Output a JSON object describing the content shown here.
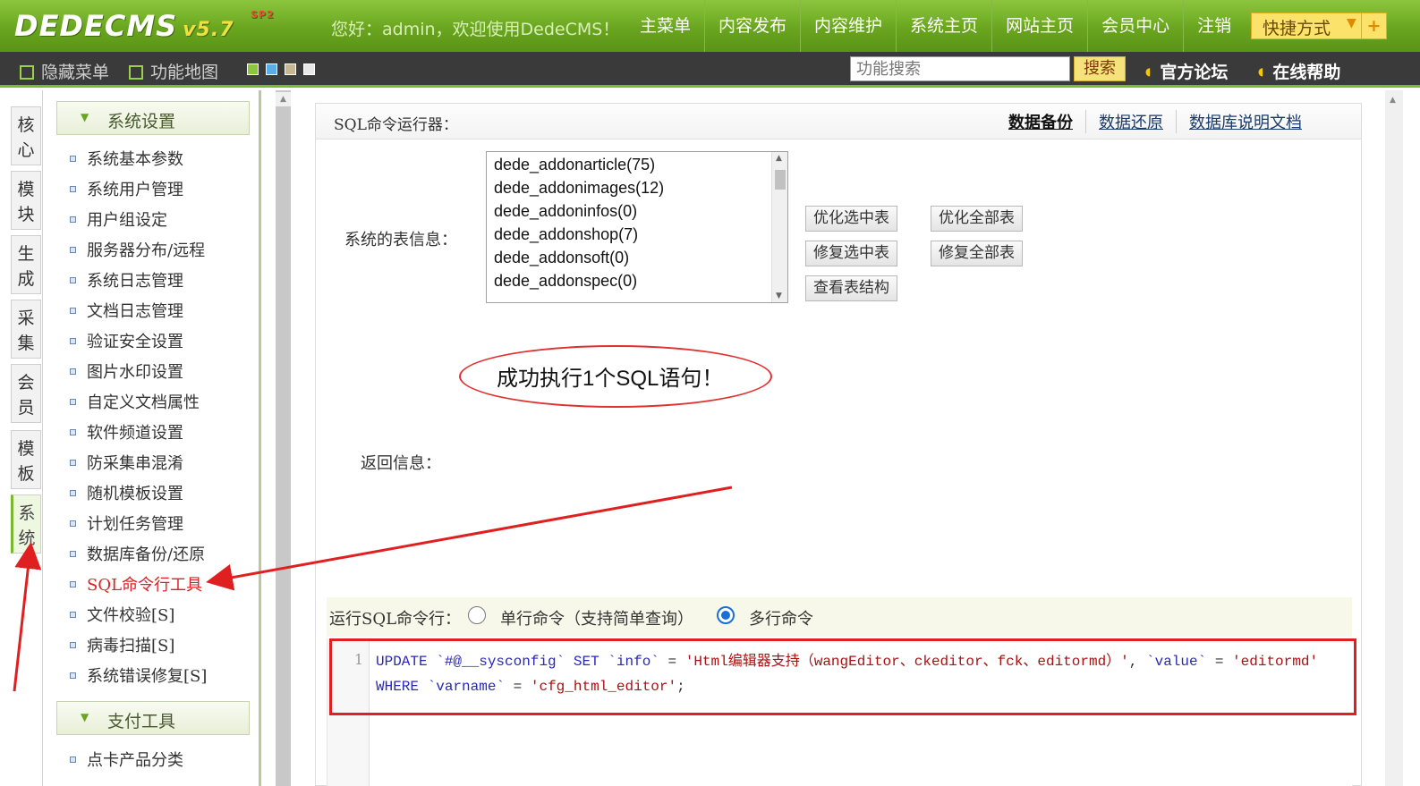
{
  "header": {
    "logo": "DEDECMS",
    "version": "v5.7",
    "sp": "SP2",
    "welcome": "您好：admin，欢迎使用DedeCMS！",
    "nav": [
      "主菜单",
      "内容发布",
      "内容维护",
      "系统主页",
      "网站主页",
      "会员中心",
      "注销"
    ],
    "quick": "快捷方式",
    "quick_arrow": "▼",
    "quick_plus": "+"
  },
  "subbar": {
    "hide_menu": "隐藏菜单",
    "func_map": "功能地图",
    "swatches": [
      "#8cc63f",
      "#5aaee8",
      "#c8b890",
      "#e8e8e8"
    ],
    "search_placeholder": "功能搜索",
    "search_button": "搜索",
    "forum": "官方论坛",
    "help": "在线帮助"
  },
  "left_tabs": [
    {
      "label": "核心",
      "active": false
    },
    {
      "label": "模块",
      "active": false
    },
    {
      "label": "生成",
      "active": false
    },
    {
      "label": "采集",
      "active": false
    },
    {
      "label": "会员",
      "active": false
    },
    {
      "label": "模板",
      "active": false
    },
    {
      "label": "系统",
      "active": true
    }
  ],
  "sidebar": {
    "section1": "系统设置",
    "items": [
      "系统基本参数",
      "系统用户管理",
      "用户组设定",
      "服务器分布/远程",
      "系统日志管理",
      "文档日志管理",
      "验证安全设置",
      "图片水印设置",
      "自定义文档属性",
      "软件频道设置",
      "防采集串混淆",
      "随机模板设置",
      "计划任务管理",
      "数据库备份/还原",
      "SQL命令行工具",
      "文件校验[S]",
      "病毒扫描[S]",
      "系统错误修复[S]"
    ],
    "active_index": 14,
    "section2": "支付工具",
    "items2": [
      "点卡产品分类"
    ]
  },
  "main": {
    "title": "SQL命令运行器：",
    "links": [
      "数据备份",
      "数据还原",
      "数据库说明文档"
    ],
    "table_label": "系统的表信息：",
    "tables": [
      "dede_addonarticle(75)",
      "dede_addonimages(12)",
      "dede_addoninfos(0)",
      "dede_addonshop(7)",
      "dede_addonsoft(0)",
      "dede_addonspec(0)"
    ],
    "buttons": {
      "optimize_selected": "优化选中表",
      "optimize_all": "优化全部表",
      "repair_selected": "修复选中表",
      "repair_all": "修复全部表",
      "view_structure": "查看表结构"
    },
    "success_message": "成功执行1个SQL语句！",
    "return_label": "返回信息：",
    "run_label": "运行SQL命令行：",
    "mode_single": "单行命令（支持简单查询）",
    "mode_multi": "多行命令",
    "selected_mode": "multi",
    "line_number": "1"
  },
  "sql_code": {
    "kw_update": "UPDATE",
    "table": "`#@__sysconfig`",
    "kw_set": "SET",
    "col_info": "`info`",
    "eq": "=",
    "val_info": "'Html编辑器支持（wangEditor、ckeditor、fck、editormd）'",
    "comma": ",",
    "col_value": "`value`",
    "val_value": "'editormd'",
    "kw_where": "WHERE",
    "col_varname": "`varname`",
    "val_varname": "'cfg_html_editor'",
    "semicolon": ";"
  },
  "colors": {
    "annotation": "#e02020",
    "brand_green": "#7cb832"
  }
}
